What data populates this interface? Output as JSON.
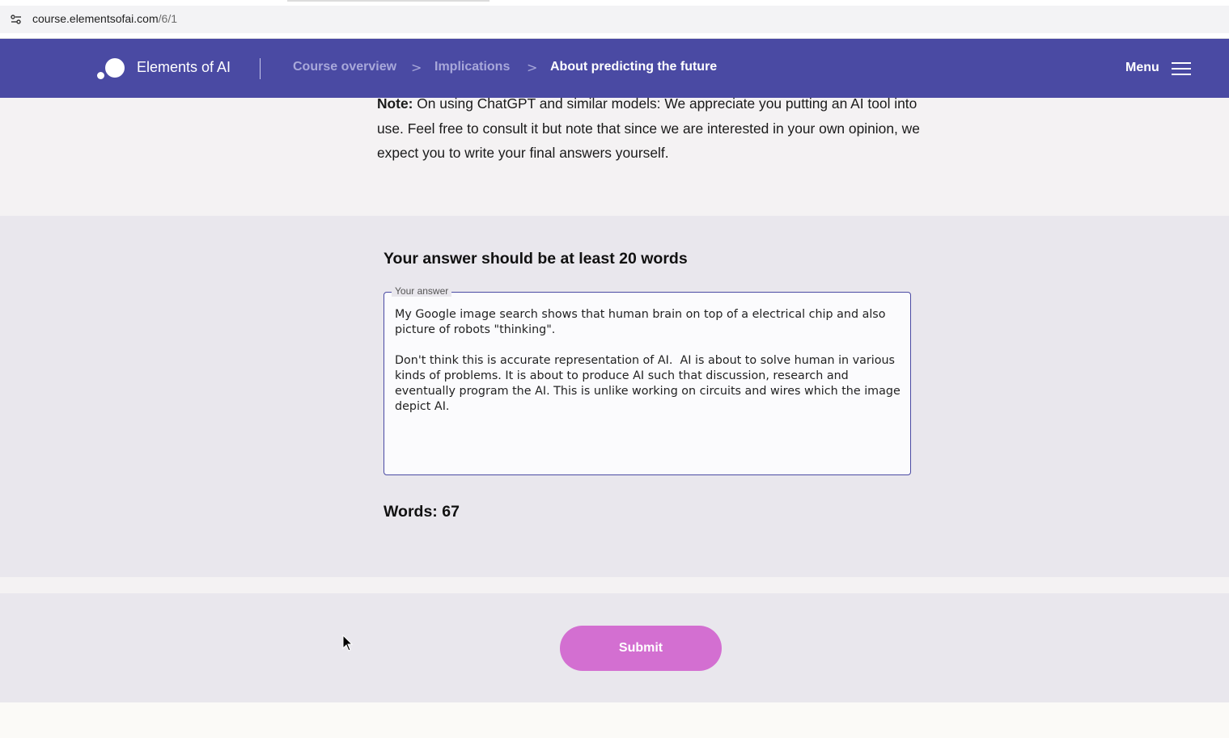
{
  "browser": {
    "url_host": "course.elementsofai.com",
    "url_path": "/6/1",
    "site_info_icon": "site-settings-icon"
  },
  "header": {
    "brand": "Elements of AI",
    "breadcrumbs": [
      {
        "label": "Course overview"
      },
      {
        "label": "Implications"
      },
      {
        "label": "About predicting the future"
      }
    ],
    "separator": ">",
    "menu_label": "Menu",
    "menu_icon": "hamburger-icon",
    "background": "#4a4aa3"
  },
  "note": {
    "label": "Note:",
    "text": " On using ChatGPT and similar models: We appreciate you putting an AI tool into use. Feel free to consult it but note that since we are interested in your own opinion, we expect you to write your final answers yourself."
  },
  "answer": {
    "title": "Your answer should be at least 20 words",
    "field_label": "Your answer",
    "value": "My Google image search shows that human brain on top of a electrical chip and also picture of robots \"thinking\".\n\nDon't think this is accurate representation of AI.  AI is about to solve human in various kinds of problems. It is about to produce AI such that discussion, research and eventually program the AI. This is unlike working on circuits and wires which the image depict AI.",
    "word_count_label": "Words: 67"
  },
  "actions": {
    "submit_label": "Submit",
    "submit_color": "#d36fd1"
  }
}
